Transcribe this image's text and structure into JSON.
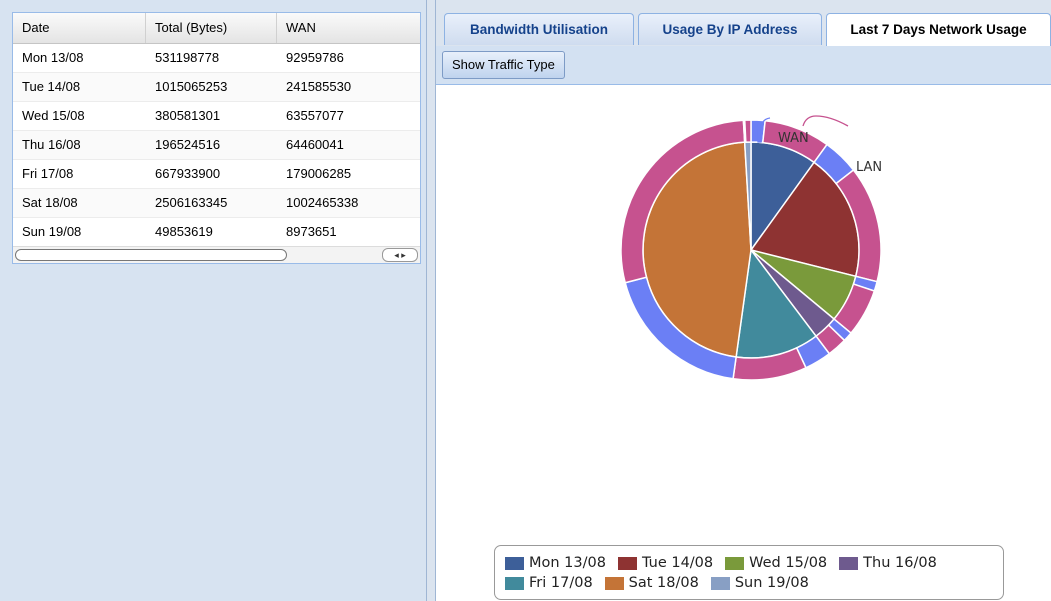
{
  "grid": {
    "columns": [
      "Date",
      "Total (Bytes)",
      "WAN"
    ],
    "rows": [
      [
        "Mon 13/08",
        "531198778",
        "92959786"
      ],
      [
        "Tue 14/08",
        "1015065253",
        "241585530"
      ],
      [
        "Wed 15/08",
        "380581301",
        "63557077"
      ],
      [
        "Thu 16/08",
        "196524516",
        "64460041"
      ],
      [
        "Fri 17/08",
        "667933900",
        "179006285"
      ],
      [
        "Sat 18/08",
        "2506163345",
        "1002465338"
      ],
      [
        "Sun 19/08",
        "49853619",
        "8973651"
      ]
    ],
    "scroll_arrows": "◂ ▸"
  },
  "tabs": [
    {
      "label": "Bandwidth Utilisation",
      "active": false
    },
    {
      "label": "Usage By IP Address",
      "active": false
    },
    {
      "label": "Last 7 Days Network Usage",
      "active": true
    }
  ],
  "toolbar": {
    "traffic_button": "Show Traffic Type"
  },
  "chart": {
    "outer_labels": {
      "wan": "WAN",
      "lan": "LAN"
    },
    "colors": {
      "Mon 13/08": "#3d5f99",
      "Tue 14/08": "#8e3332",
      "Wed 15/08": "#7a9a3b",
      "Thu 16/08": "#6e5a8e",
      "Fri 17/08": "#418a9c",
      "Sat 18/08": "#c47437",
      "Sun 19/08": "#889fc4",
      "WAN": "#6b7ff5",
      "LAN": "#c6528f"
    }
  },
  "chart_data": {
    "type": "pie",
    "categories": [
      "Mon 13/08",
      "Tue 14/08",
      "Wed 15/08",
      "Thu 16/08",
      "Fri 17/08",
      "Sat 18/08",
      "Sun 19/08"
    ],
    "values": [
      531198778,
      1015065253,
      380581301,
      196524516,
      667933900,
      2506163345,
      49853619
    ],
    "series": [
      {
        "name": "WAN",
        "values": [
          92959786,
          241585530,
          63557077,
          64460041,
          179006285,
          1002465338,
          8973651
        ]
      },
      {
        "name": "LAN",
        "values": [
          438238992,
          773479723,
          317024224,
          132064475,
          488927615,
          1503698007,
          40879968
        ]
      }
    ],
    "legend": [
      "Mon 13/08",
      "Tue 14/08",
      "Wed 15/08",
      "Thu 16/08",
      "Fri 17/08",
      "Sat 18/08",
      "Sun 19/08"
    ],
    "legend_position": "bottom"
  }
}
